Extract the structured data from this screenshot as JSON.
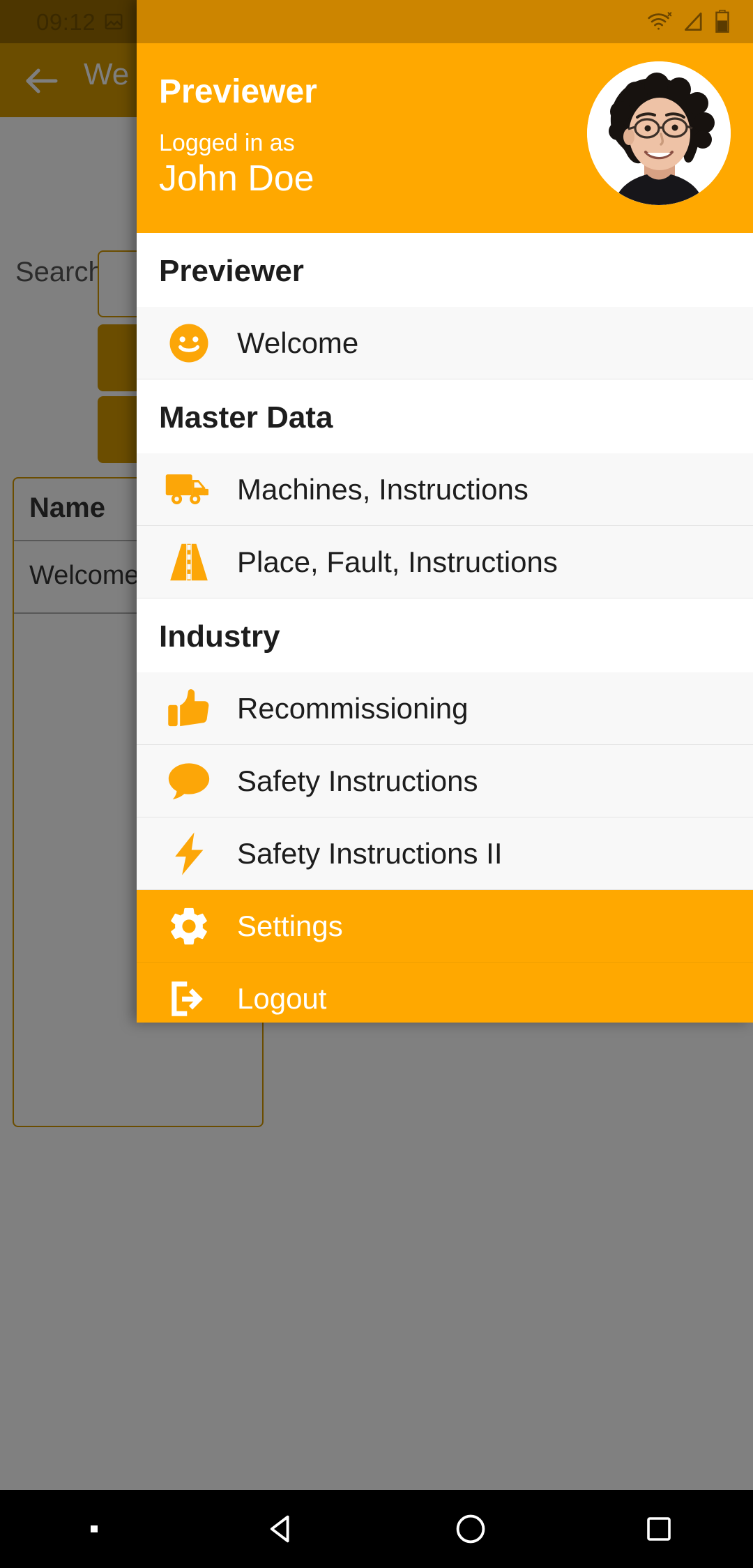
{
  "status_bar": {
    "time": "09:12",
    "left_icons": [
      "image-icon",
      "no-sim-icon"
    ],
    "right_icons": [
      "wifi-no-internet-icon",
      "signal-icon",
      "battery-icon"
    ]
  },
  "background_app": {
    "back_button": "back-arrow-icon",
    "title": "We",
    "search_label": "Search",
    "search_value": "",
    "table": {
      "header": "Name",
      "rows": [
        "Welcome"
      ]
    }
  },
  "drawer": {
    "header": {
      "app_name": "Previewer",
      "logged_in_label": "Logged in as",
      "user_name": "John Doe",
      "avatar": "user-avatar-photo"
    },
    "sections": [
      {
        "title": "Previewer",
        "items": [
          {
            "label": "Welcome",
            "icon": "smiley-face-icon",
            "active": false
          }
        ]
      },
      {
        "title": "Master Data",
        "items": [
          {
            "label": "Machines, Instructions",
            "icon": "truck-icon",
            "active": false
          },
          {
            "label": "Place, Fault, Instructions",
            "icon": "road-icon",
            "active": false
          }
        ]
      },
      {
        "title": "Industry",
        "items": [
          {
            "label": "Recommissioning",
            "icon": "thumbs-up-icon",
            "active": false
          },
          {
            "label": "Safety Instructions",
            "icon": "speech-bubble-icon",
            "active": false
          },
          {
            "label": "Safety Instructions II",
            "icon": "lightning-bolt-icon",
            "active": false
          },
          {
            "label": "Settings",
            "icon": "gear-icon",
            "active": true
          },
          {
            "label": "Logout",
            "icon": "logout-icon",
            "active": true
          }
        ]
      }
    ]
  },
  "nav_bar": {
    "buttons": [
      "recent-apps-square-icon",
      "back-triangle-icon",
      "home-circle-icon",
      "overview-square-icon"
    ]
  },
  "colors": {
    "accent": "#ffa800",
    "accent_dark": "#cc8500",
    "scrim": "#808080",
    "list_bg": "#f8f8f8",
    "section_bg": "#ffffff"
  }
}
